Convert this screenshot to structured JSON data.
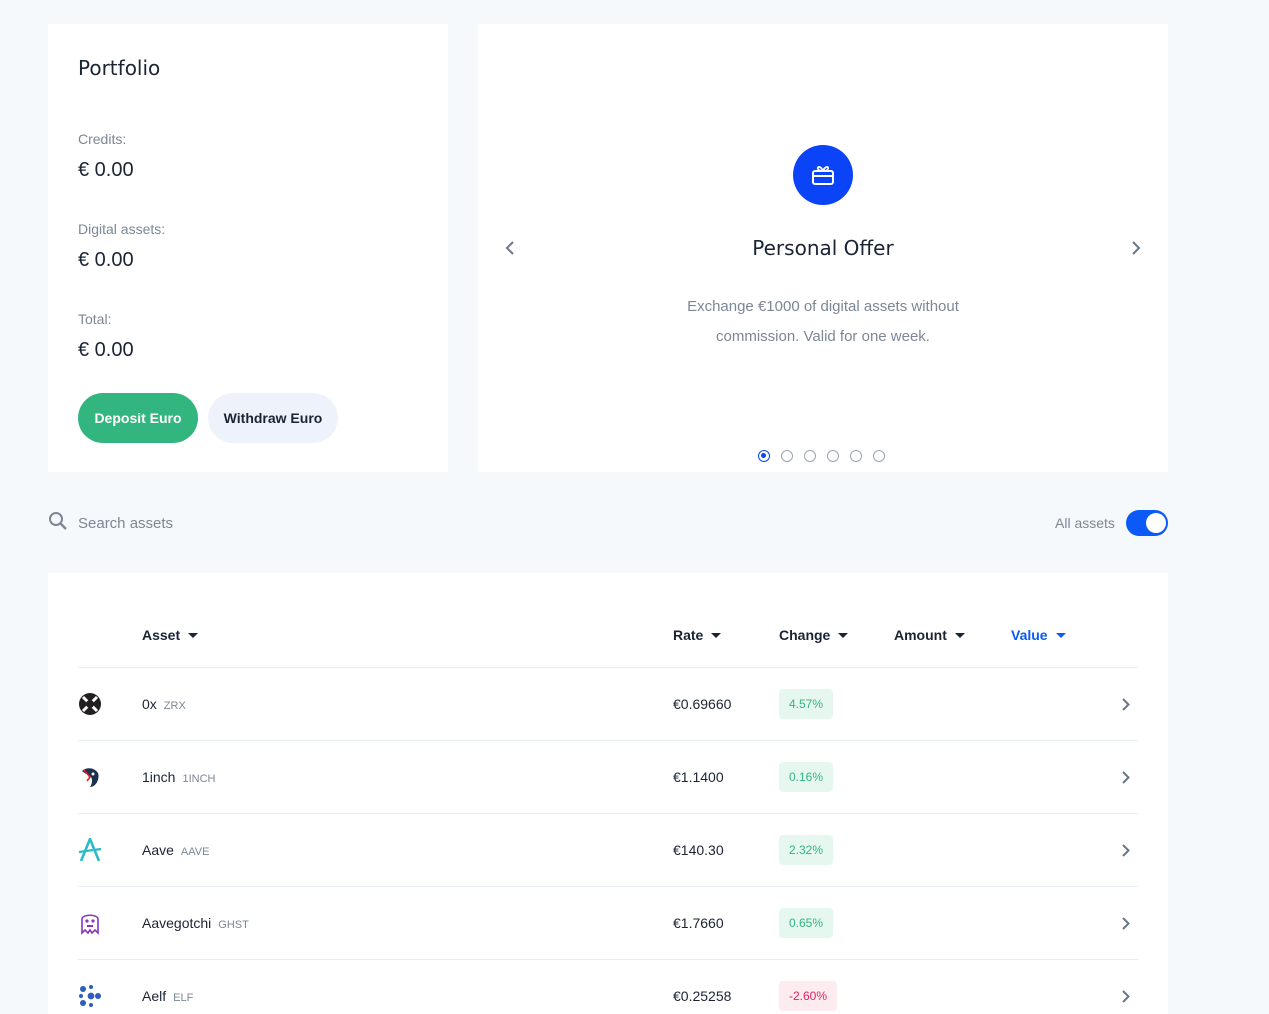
{
  "portfolio": {
    "title": "Portfolio",
    "credits_label": "Credits:",
    "credits_value": "€ 0.00",
    "digital_label": "Digital assets:",
    "digital_value": "€ 0.00",
    "total_label": "Total:",
    "total_value": "€ 0.00",
    "deposit_label": "Deposit Euro",
    "withdraw_label": "Withdraw Euro"
  },
  "offer": {
    "icon": "gift-card-icon",
    "title": "Personal Offer",
    "text": "Exchange €1000 of digital assets without commission. Valid for one week.",
    "slide_count": 6,
    "active_slide": 1
  },
  "search": {
    "placeholder": "Search assets",
    "toggle_label": "All assets",
    "toggle_on": true
  },
  "table": {
    "headers": {
      "asset": "Asset",
      "rate": "Rate",
      "change": "Change",
      "amount": "Amount",
      "value": "Value"
    },
    "rows": [
      {
        "name": "0x",
        "symbol": "ZRX",
        "rate": "€0.69660",
        "change": "4.57%",
        "positive": true
      },
      {
        "name": "1inch",
        "symbol": "1INCH",
        "rate": "€1.1400",
        "change": "0.16%",
        "positive": true
      },
      {
        "name": "Aave",
        "symbol": "AAVE",
        "rate": "€140.30",
        "change": "2.32%",
        "positive": true
      },
      {
        "name": "Aavegotchi",
        "symbol": "GHST",
        "rate": "€1.7660",
        "change": "0.65%",
        "positive": true
      },
      {
        "name": "Aelf",
        "symbol": "ELF",
        "rate": "€0.25258",
        "change": "-2.60%",
        "positive": false
      }
    ]
  },
  "colors": {
    "accent": "#0b43f6",
    "positive": "#33b57f",
    "negative": "#e0245e",
    "background": "#f5f9fc"
  }
}
